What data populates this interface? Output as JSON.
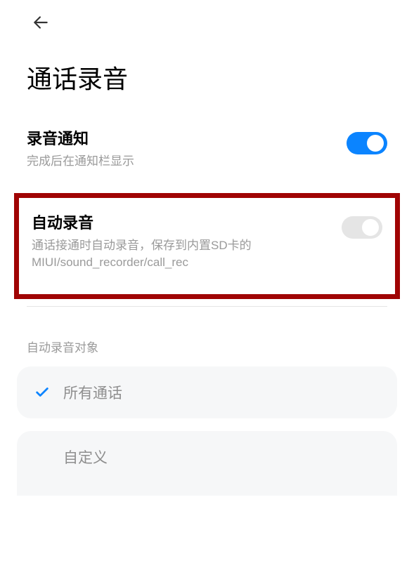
{
  "page": {
    "title": "通话录音"
  },
  "settings": {
    "notification": {
      "title": "录音通知",
      "desc": "完成后在通知栏显示",
      "enabled": true
    },
    "auto_record": {
      "title": "自动录音",
      "desc": "通话接通时自动录音，保存到内置SD卡的MIUI/sound_recorder/call_rec",
      "enabled": false
    }
  },
  "auto_record_target": {
    "section_title": "自动录音对象",
    "options": [
      {
        "label": "所有通话",
        "selected": true
      },
      {
        "label": "自定义",
        "selected": false
      }
    ]
  }
}
